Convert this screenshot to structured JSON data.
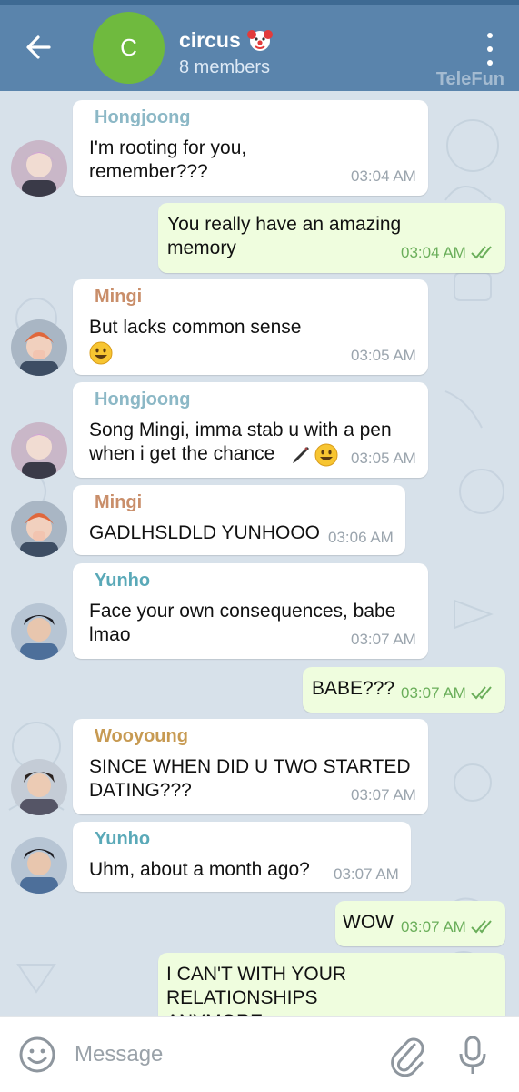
{
  "header": {
    "back_icon": "arrow-left-icon",
    "avatar_letter": "C",
    "title": "circus",
    "title_emoji": "clown-face",
    "subtitle": "8 members",
    "menu_icon": "more-vertical-icon",
    "watermark": "TeleFun",
    "bar_color": "#5a84ac",
    "avatar_color": "#6fba3e"
  },
  "messages": [
    {
      "sender": "Hongjoong",
      "text": "I'm rooting for you,\nremember???",
      "time": "03:04 AM"
    },
    {
      "text": "You really have an amazing\nmemory",
      "time": "03:04 AM",
      "status": "read"
    },
    {
      "sender": "Mingi",
      "text": "But lacks common sense",
      "time": "03:05 AM"
    },
    {
      "sender": "Hongjoong",
      "text": "Song Mingi, imma stab u with a pen\nwhen i get the chance",
      "time": "03:05 AM"
    },
    {
      "sender": "Mingi",
      "text": "GADLHSLDLD YUNHOOO",
      "time": "03:06 AM"
    },
    {
      "sender": "Yunho",
      "text": "Face your own consequences, babe\nlmao",
      "time": "03:07 AM"
    },
    {
      "text": "BABE???",
      "time": "03:07 AM",
      "status": "read"
    },
    {
      "sender": "Wooyoung",
      "text": "SINCE WHEN DID U TWO STARTED\nDATING???",
      "time": "03:07 AM"
    },
    {
      "sender": "Yunho",
      "text": "Uhm, about a month ago?",
      "time": "03:07 AM"
    },
    {
      "text": "WOW",
      "time": "03:07 AM",
      "status": "read"
    },
    {
      "text": "I CAN'T WITH YOUR\nRELATIONSHIPS\nANYMORE"
    }
  ],
  "sender_colors": {
    "Hongjoong": "#8cb8c6",
    "Mingi": "#c98e6a",
    "Yunho": "#5aa9b8",
    "Wooyoung": "#c79a52"
  },
  "input": {
    "placeholder": "Message",
    "emoji_icon": "smile-icon",
    "attach_icon": "paperclip-icon",
    "mic_icon": "microphone-icon"
  }
}
